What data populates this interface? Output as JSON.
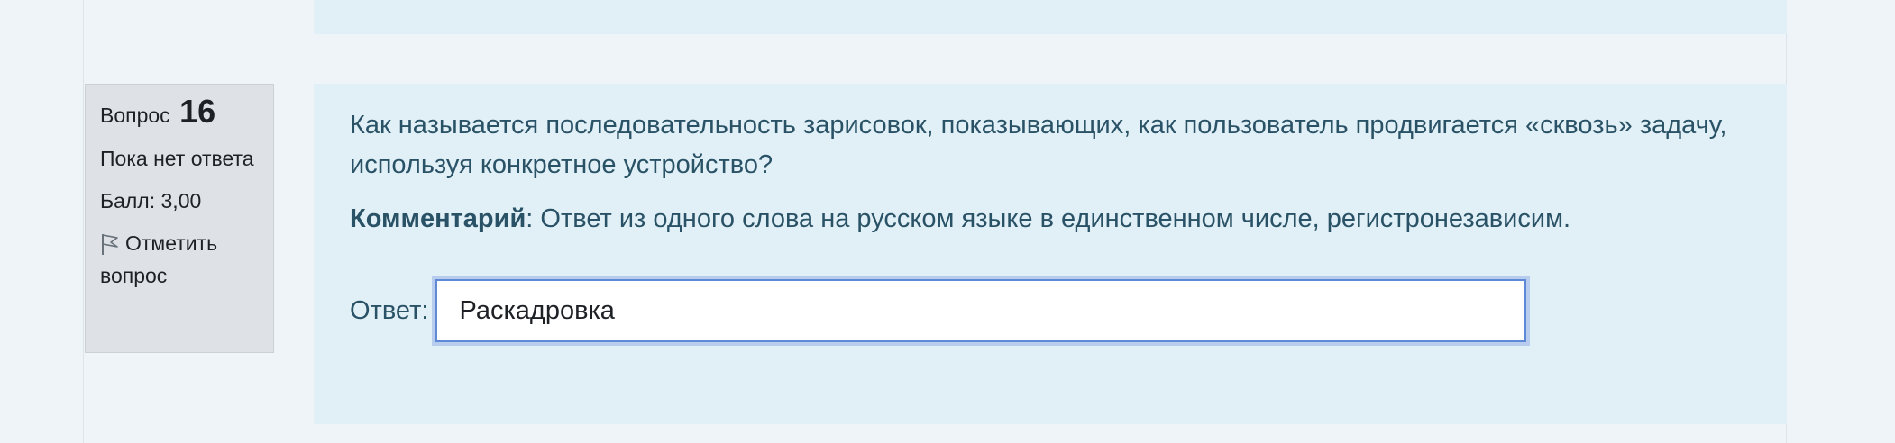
{
  "question_info": {
    "label": "Вопрос",
    "number": "16",
    "state": "Пока нет ответа",
    "grade": "Балл: 3,00",
    "flag_label": "Отметить вопрос"
  },
  "question": {
    "text": "Как называется последовательность зарисовок, показывающих, как пользователь продвигается «сквозь» задачу, используя конкретное устройство?",
    "comment_label": "Комментарий",
    "comment_text": ": Ответ из одного слова на русском языке в единственном числе, регистронезависим."
  },
  "answer": {
    "label": "Ответ:",
    "value": "Раскадровка"
  },
  "icons": {
    "flag": "flag-icon"
  }
}
